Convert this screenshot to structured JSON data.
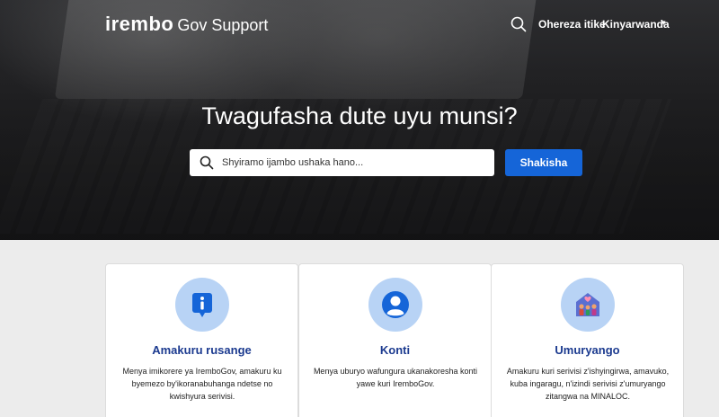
{
  "header": {
    "logo_brand": "irembo",
    "logo_sub": "Gov Support",
    "sign_in": "Ohereza itike",
    "language": "Kinyarwanda",
    "caret": "▾"
  },
  "hero": {
    "title": "Twagufasha dute uyu munsi?",
    "search_placeholder": "Shyiramo ijambo ushaka hano...",
    "search_button": "Shakisha"
  },
  "cards": [
    {
      "icon": "info-icon",
      "title": "Amakuru rusange",
      "description": "Menya imikorere ya IremboGov, amakuru ku byemezo by'ikoranabuhanga ndetse no kwishyura serivisi."
    },
    {
      "icon": "user-icon",
      "title": "Konti",
      "description": "Menya uburyo wafungura ukanakoresha konti yawe kuri IremboGov."
    },
    {
      "icon": "family-house-icon",
      "title": "Umuryango",
      "description": "Amakuru kuri serivisi z'ishyingirwa, amavuko, kuba ingaragu, n'izindi serivisi z'umuryango zitangwa na MINALOC."
    }
  ],
  "colors": {
    "primary_button": "#1565d8",
    "card_title": "#1b3a8f",
    "icon_circle": "#b8d3f5",
    "page_background": "#ececec"
  }
}
